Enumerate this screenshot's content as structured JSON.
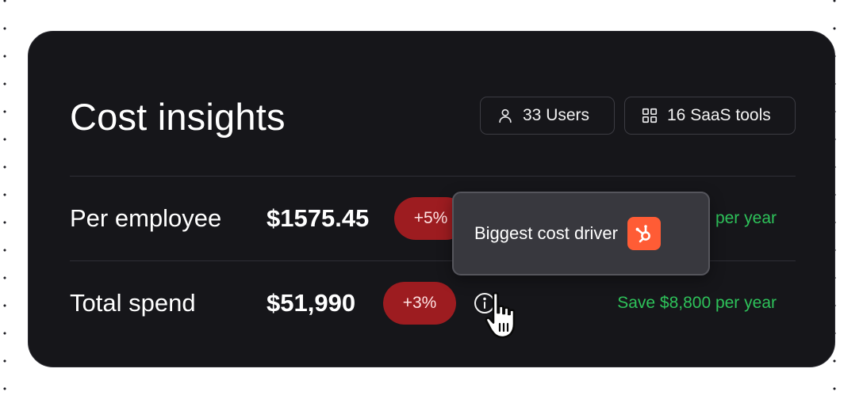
{
  "title": "Cost insights",
  "chips": {
    "users": {
      "label": "33 Users",
      "icon": "user-icon"
    },
    "tools": {
      "label": "16 SaaS tools",
      "icon": "grid-icon"
    }
  },
  "rows": [
    {
      "label": "Per employee",
      "value": "$1575.45",
      "change": "+5%",
      "savings": "per year"
    },
    {
      "label": "Total spend",
      "value": "$51,990",
      "change": "+3%",
      "savings": "Save $8,800 per year",
      "icon": "info-icon"
    }
  ],
  "tooltip": {
    "text": "Biggest cost driver",
    "icon": "hubspot-logo"
  },
  "colors": {
    "card_bg": "#16161a",
    "change_pill": "#9d1c20",
    "savings_text": "#2ec25a",
    "tooltip_bg": "#38383e",
    "hubspot": "#ff5c35"
  }
}
